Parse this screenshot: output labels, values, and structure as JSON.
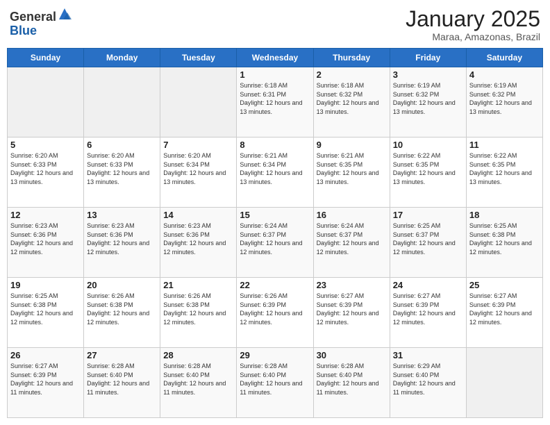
{
  "logo": {
    "general": "General",
    "blue": "Blue"
  },
  "header": {
    "month_title": "January 2025",
    "subtitle": "Maraa, Amazonas, Brazil"
  },
  "weekdays": [
    "Sunday",
    "Monday",
    "Tuesday",
    "Wednesday",
    "Thursday",
    "Friday",
    "Saturday"
  ],
  "weeks": [
    [
      {
        "day": "",
        "info": ""
      },
      {
        "day": "",
        "info": ""
      },
      {
        "day": "",
        "info": ""
      },
      {
        "day": "1",
        "info": "Sunrise: 6:18 AM\nSunset: 6:31 PM\nDaylight: 12 hours and 13 minutes."
      },
      {
        "day": "2",
        "info": "Sunrise: 6:18 AM\nSunset: 6:32 PM\nDaylight: 12 hours and 13 minutes."
      },
      {
        "day": "3",
        "info": "Sunrise: 6:19 AM\nSunset: 6:32 PM\nDaylight: 12 hours and 13 minutes."
      },
      {
        "day": "4",
        "info": "Sunrise: 6:19 AM\nSunset: 6:32 PM\nDaylight: 12 hours and 13 minutes."
      }
    ],
    [
      {
        "day": "5",
        "info": "Sunrise: 6:20 AM\nSunset: 6:33 PM\nDaylight: 12 hours and 13 minutes."
      },
      {
        "day": "6",
        "info": "Sunrise: 6:20 AM\nSunset: 6:33 PM\nDaylight: 12 hours and 13 minutes."
      },
      {
        "day": "7",
        "info": "Sunrise: 6:20 AM\nSunset: 6:34 PM\nDaylight: 12 hours and 13 minutes."
      },
      {
        "day": "8",
        "info": "Sunrise: 6:21 AM\nSunset: 6:34 PM\nDaylight: 12 hours and 13 minutes."
      },
      {
        "day": "9",
        "info": "Sunrise: 6:21 AM\nSunset: 6:35 PM\nDaylight: 12 hours and 13 minutes."
      },
      {
        "day": "10",
        "info": "Sunrise: 6:22 AM\nSunset: 6:35 PM\nDaylight: 12 hours and 13 minutes."
      },
      {
        "day": "11",
        "info": "Sunrise: 6:22 AM\nSunset: 6:35 PM\nDaylight: 12 hours and 13 minutes."
      }
    ],
    [
      {
        "day": "12",
        "info": "Sunrise: 6:23 AM\nSunset: 6:36 PM\nDaylight: 12 hours and 12 minutes."
      },
      {
        "day": "13",
        "info": "Sunrise: 6:23 AM\nSunset: 6:36 PM\nDaylight: 12 hours and 12 minutes."
      },
      {
        "day": "14",
        "info": "Sunrise: 6:23 AM\nSunset: 6:36 PM\nDaylight: 12 hours and 12 minutes."
      },
      {
        "day": "15",
        "info": "Sunrise: 6:24 AM\nSunset: 6:37 PM\nDaylight: 12 hours and 12 minutes."
      },
      {
        "day": "16",
        "info": "Sunrise: 6:24 AM\nSunset: 6:37 PM\nDaylight: 12 hours and 12 minutes."
      },
      {
        "day": "17",
        "info": "Sunrise: 6:25 AM\nSunset: 6:37 PM\nDaylight: 12 hours and 12 minutes."
      },
      {
        "day": "18",
        "info": "Sunrise: 6:25 AM\nSunset: 6:38 PM\nDaylight: 12 hours and 12 minutes."
      }
    ],
    [
      {
        "day": "19",
        "info": "Sunrise: 6:25 AM\nSunset: 6:38 PM\nDaylight: 12 hours and 12 minutes."
      },
      {
        "day": "20",
        "info": "Sunrise: 6:26 AM\nSunset: 6:38 PM\nDaylight: 12 hours and 12 minutes."
      },
      {
        "day": "21",
        "info": "Sunrise: 6:26 AM\nSunset: 6:38 PM\nDaylight: 12 hours and 12 minutes."
      },
      {
        "day": "22",
        "info": "Sunrise: 6:26 AM\nSunset: 6:39 PM\nDaylight: 12 hours and 12 minutes."
      },
      {
        "day": "23",
        "info": "Sunrise: 6:27 AM\nSunset: 6:39 PM\nDaylight: 12 hours and 12 minutes."
      },
      {
        "day": "24",
        "info": "Sunrise: 6:27 AM\nSunset: 6:39 PM\nDaylight: 12 hours and 12 minutes."
      },
      {
        "day": "25",
        "info": "Sunrise: 6:27 AM\nSunset: 6:39 PM\nDaylight: 12 hours and 12 minutes."
      }
    ],
    [
      {
        "day": "26",
        "info": "Sunrise: 6:27 AM\nSunset: 6:39 PM\nDaylight: 12 hours and 11 minutes."
      },
      {
        "day": "27",
        "info": "Sunrise: 6:28 AM\nSunset: 6:40 PM\nDaylight: 12 hours and 11 minutes."
      },
      {
        "day": "28",
        "info": "Sunrise: 6:28 AM\nSunset: 6:40 PM\nDaylight: 12 hours and 11 minutes."
      },
      {
        "day": "29",
        "info": "Sunrise: 6:28 AM\nSunset: 6:40 PM\nDaylight: 12 hours and 11 minutes."
      },
      {
        "day": "30",
        "info": "Sunrise: 6:28 AM\nSunset: 6:40 PM\nDaylight: 12 hours and 11 minutes."
      },
      {
        "day": "31",
        "info": "Sunrise: 6:29 AM\nSunset: 6:40 PM\nDaylight: 12 hours and 11 minutes."
      },
      {
        "day": "",
        "info": ""
      }
    ]
  ]
}
